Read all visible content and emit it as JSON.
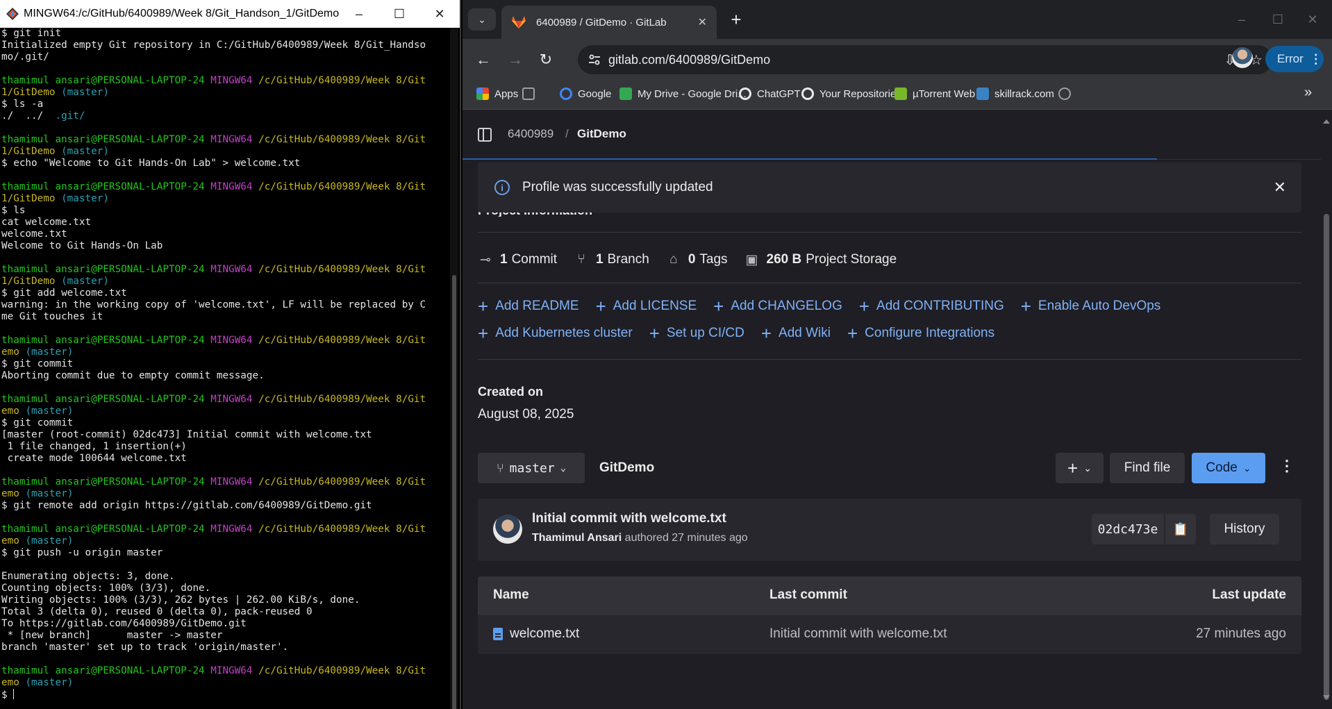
{
  "terminal": {
    "title": "MINGW64:/c/GitHub/6400989/Week 8/Git_Handson_1/GitDemo",
    "controls": {
      "minimize": "–",
      "maximize": "☐",
      "close": "✕"
    },
    "lines": [
      [
        {
          "t": "$ git init"
        }
      ],
      [
        {
          "t": "Initialized empty Git repository in C:/GitHub/6400989/Week 8/Git_Handso"
        }
      ],
      [
        {
          "t": "mo/.git/"
        }
      ],
      [
        {
          "t": ""
        }
      ],
      [
        {
          "t": "thamimul ansari@PERSONAL-LAPTOP-24",
          "c": "u"
        },
        {
          "t": " "
        },
        {
          "t": "MINGW64",
          "c": "m"
        },
        {
          "t": " "
        },
        {
          "t": "/c/GitHub/6400989/Week 8/Git",
          "c": "y"
        }
      ],
      [
        {
          "t": "1/GitDemo",
          "c": "y"
        },
        {
          "t": " "
        },
        {
          "t": "(master)",
          "c": "c"
        }
      ],
      [
        {
          "t": "$ ls -a"
        }
      ],
      [
        {
          "t": "./  ../  "
        },
        {
          "t": ".git/",
          "c": "c"
        }
      ],
      [
        {
          "t": ""
        }
      ],
      [
        {
          "t": "thamimul ansari@PERSONAL-LAPTOP-24",
          "c": "u"
        },
        {
          "t": " "
        },
        {
          "t": "MINGW64",
          "c": "m"
        },
        {
          "t": " "
        },
        {
          "t": "/c/GitHub/6400989/Week 8/Git",
          "c": "y"
        }
      ],
      [
        {
          "t": "1/GitDemo",
          "c": "y"
        },
        {
          "t": " "
        },
        {
          "t": "(master)",
          "c": "c"
        }
      ],
      [
        {
          "t": "$ echo \"Welcome to Git Hands-On Lab\" > welcome.txt"
        }
      ],
      [
        {
          "t": ""
        }
      ],
      [
        {
          "t": "thamimul ansari@PERSONAL-LAPTOP-24",
          "c": "u"
        },
        {
          "t": " "
        },
        {
          "t": "MINGW64",
          "c": "m"
        },
        {
          "t": " "
        },
        {
          "t": "/c/GitHub/6400989/Week 8/Git",
          "c": "y"
        }
      ],
      [
        {
          "t": "1/GitDemo",
          "c": "y"
        },
        {
          "t": " "
        },
        {
          "t": "(master)",
          "c": "c"
        }
      ],
      [
        {
          "t": "$ ls"
        }
      ],
      [
        {
          "t": "cat welcome.txt"
        }
      ],
      [
        {
          "t": "welcome.txt"
        }
      ],
      [
        {
          "t": "Welcome to Git Hands-On Lab"
        }
      ],
      [
        {
          "t": ""
        }
      ],
      [
        {
          "t": "thamimul ansari@PERSONAL-LAPTOP-24",
          "c": "u"
        },
        {
          "t": " "
        },
        {
          "t": "MINGW64",
          "c": "m"
        },
        {
          "t": " "
        },
        {
          "t": "/c/GitHub/6400989/Week 8/Git",
          "c": "y"
        }
      ],
      [
        {
          "t": "1/GitDemo",
          "c": "y"
        },
        {
          "t": " "
        },
        {
          "t": "(master)",
          "c": "c"
        }
      ],
      [
        {
          "t": "$ git add welcome.txt"
        }
      ],
      [
        {
          "t": "warning: in the working copy of 'welcome.txt', LF will be replaced by C"
        }
      ],
      [
        {
          "t": "me Git touches it"
        }
      ],
      [
        {
          "t": ""
        }
      ],
      [
        {
          "t": "thamimul ansari@PERSONAL-LAPTOP-24",
          "c": "u"
        },
        {
          "t": " "
        },
        {
          "t": "MINGW64",
          "c": "m"
        },
        {
          "t": " "
        },
        {
          "t": "/c/GitHub/6400989/Week 8/Git",
          "c": "y"
        }
      ],
      [
        {
          "t": "emo",
          "c": "y"
        },
        {
          "t": " "
        },
        {
          "t": "(master)",
          "c": "c"
        }
      ],
      [
        {
          "t": "$ git commit"
        }
      ],
      [
        {
          "t": "Aborting commit due to empty commit message."
        }
      ],
      [
        {
          "t": ""
        }
      ],
      [
        {
          "t": "thamimul ansari@PERSONAL-LAPTOP-24",
          "c": "u"
        },
        {
          "t": " "
        },
        {
          "t": "MINGW64",
          "c": "m"
        },
        {
          "t": " "
        },
        {
          "t": "/c/GitHub/6400989/Week 8/Git",
          "c": "y"
        }
      ],
      [
        {
          "t": "emo",
          "c": "y"
        },
        {
          "t": " "
        },
        {
          "t": "(master)",
          "c": "c"
        }
      ],
      [
        {
          "t": "$ git commit"
        }
      ],
      [
        {
          "t": "[master (root-commit) 02dc473] Initial commit with welcome.txt"
        }
      ],
      [
        {
          "t": " 1 file changed, 1 insertion(+)"
        }
      ],
      [
        {
          "t": " create mode 100644 welcome.txt"
        }
      ],
      [
        {
          "t": ""
        }
      ],
      [
        {
          "t": "thamimul ansari@PERSONAL-LAPTOP-24",
          "c": "u"
        },
        {
          "t": " "
        },
        {
          "t": "MINGW64",
          "c": "m"
        },
        {
          "t": " "
        },
        {
          "t": "/c/GitHub/6400989/Week 8/Git",
          "c": "y"
        }
      ],
      [
        {
          "t": "emo",
          "c": "y"
        },
        {
          "t": " "
        },
        {
          "t": "(master)",
          "c": "c"
        }
      ],
      [
        {
          "t": "$ git remote add origin https://gitlab.com/6400989/GitDemo.git"
        }
      ],
      [
        {
          "t": ""
        }
      ],
      [
        {
          "t": "thamimul ansari@PERSONAL-LAPTOP-24",
          "c": "u"
        },
        {
          "t": " "
        },
        {
          "t": "MINGW64",
          "c": "m"
        },
        {
          "t": " "
        },
        {
          "t": "/c/GitHub/6400989/Week 8/Git",
          "c": "y"
        }
      ],
      [
        {
          "t": "emo",
          "c": "y"
        },
        {
          "t": " "
        },
        {
          "t": "(master)",
          "c": "c"
        }
      ],
      [
        {
          "t": "$ git push -u origin master"
        }
      ],
      [
        {
          "t": ""
        }
      ],
      [
        {
          "t": "Enumerating objects: 3, done."
        }
      ],
      [
        {
          "t": "Counting objects: 100% (3/3), done."
        }
      ],
      [
        {
          "t": "Writing objects: 100% (3/3), 262 bytes | 262.00 KiB/s, done."
        }
      ],
      [
        {
          "t": "Total 3 (delta 0), reused 0 (delta 0), pack-reused 0"
        }
      ],
      [
        {
          "t": "To https://gitlab.com/6400989/GitDemo.git"
        }
      ],
      [
        {
          "t": " * [new branch]      master -> master"
        }
      ],
      [
        {
          "t": "branch 'master' set up to track 'origin/master'."
        }
      ],
      [
        {
          "t": ""
        }
      ],
      [
        {
          "t": "thamimul ansari@PERSONAL-LAPTOP-24",
          "c": "u"
        },
        {
          "t": " "
        },
        {
          "t": "MINGW64",
          "c": "m"
        },
        {
          "t": " "
        },
        {
          "t": "/c/GitHub/6400989/Week 8/Git",
          "c": "y"
        }
      ],
      [
        {
          "t": "emo",
          "c": "y"
        },
        {
          "t": " "
        },
        {
          "t": "(master)",
          "c": "c"
        }
      ],
      [
        {
          "t": "$ "
        }
      ]
    ]
  },
  "browser": {
    "tab_title": "6400989 / GitDemo · GitLab",
    "new_tab": "+",
    "controls": {
      "minimize": "–",
      "maximize": "☐",
      "close": "✕"
    },
    "url": "gitlab.com/6400989/GitDemo",
    "error_button": "Error",
    "bookmarks": [
      {
        "label": "Apps",
        "icon": "apps-grid-icon",
        "color": "#ea4335"
      },
      {
        "label": "",
        "icon": "tab-groups-icon",
        "color": "#9aa0a6"
      },
      {
        "label": "Google",
        "icon": "google-icon",
        "color": "#4285f4"
      },
      {
        "label": "My Drive - Google Dri...",
        "icon": "google-drive-icon",
        "color": "#34a853"
      },
      {
        "label": "ChatGPT",
        "icon": "chatgpt-icon",
        "color": "#e8eaed"
      },
      {
        "label": "Your Repositories",
        "icon": "github-icon",
        "color": "#e8eaed"
      },
      {
        "label": "µTorrent Web",
        "icon": "utorrent-icon",
        "color": "#76b82a"
      },
      {
        "label": "skillrack.com",
        "icon": "skillrack-icon",
        "color": "#3b82c4"
      },
      {
        "label": "",
        "icon": "globe-icon",
        "color": "#9aa0a6"
      }
    ],
    "more_bookmarks": "»"
  },
  "gitlab": {
    "breadcrumb": {
      "group": "6400989",
      "separator": "/",
      "project": "GitDemo"
    },
    "alert": "Profile was successfully updated",
    "section_heading": "Project information",
    "stats": [
      {
        "value": "1",
        "label": "Commit",
        "icon": "commit-icon"
      },
      {
        "value": "1",
        "label": "Branch",
        "icon": "branch-icon"
      },
      {
        "value": "0",
        "label": "Tags",
        "icon": "tag-icon"
      },
      {
        "value": "260 B",
        "label": "Project Storage",
        "icon": "storage-icon"
      }
    ],
    "add_links_row1": [
      "Add README",
      "Add LICENSE",
      "Add CHANGELOG",
      "Add CONTRIBUTING",
      "Enable Auto DevOps"
    ],
    "add_links_row2": [
      "Add Kubernetes cluster",
      "Set up CI/CD",
      "Add Wiki",
      "Configure Integrations"
    ],
    "created_label": "Created on",
    "created_value": "August 08, 2025",
    "branch": "master",
    "project_name": "GitDemo",
    "find_file": "Find file",
    "code": "Code",
    "commit": {
      "title": "Initial commit with welcome.txt",
      "author": "Thamimul Ansari",
      "authored_text": "authored 27 minutes ago",
      "sha": "02dc473e",
      "history": "History"
    },
    "table": {
      "headers": [
        "Name",
        "Last commit",
        "Last update"
      ],
      "rows": [
        {
          "name": "welcome.txt",
          "last_commit": "Initial commit with welcome.txt",
          "last_update": "27 minutes ago"
        }
      ]
    },
    "colors": {
      "accent": "#7fb2f8",
      "primary_button": "#5b9df1",
      "background": "#1f1e24"
    }
  }
}
